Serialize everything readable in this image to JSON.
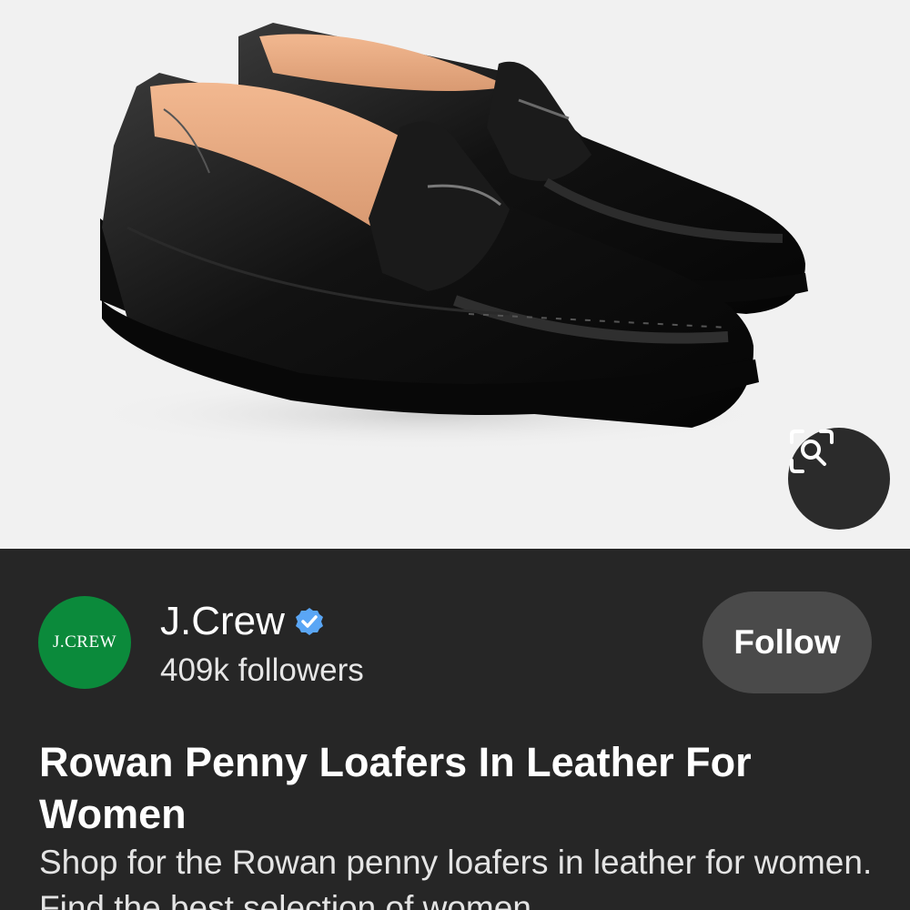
{
  "product_image": {
    "description_icon": "black-penny-loafers-photo"
  },
  "lens": {
    "icon": "visual-search-icon"
  },
  "brand": {
    "logo_text": "J.CREW",
    "name": "J.Crew",
    "verified_icon": "verified-badge-icon",
    "followers": "409k followers",
    "follow_label": "Follow",
    "logo_color": "#0b8a3b"
  },
  "product": {
    "title": "Rowan Penny Loafers In Leather For Women",
    "description": "Shop for the Rowan penny loafers in leather for women. Find the best selection of women"
  }
}
